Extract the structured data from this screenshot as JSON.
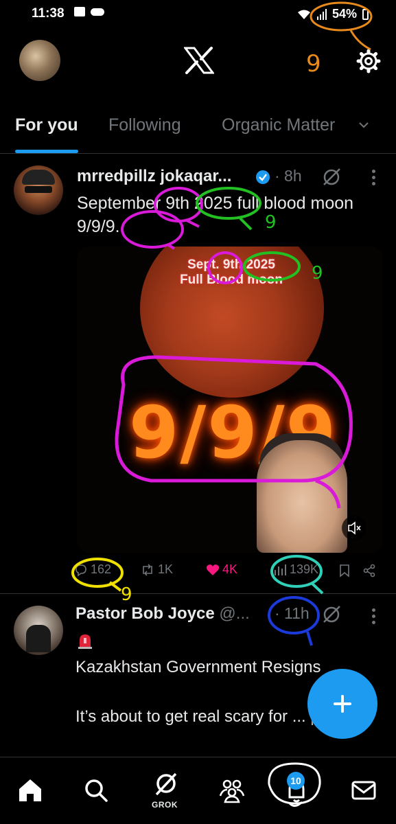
{
  "status_bar": {
    "time": "11:38",
    "battery": "54%"
  },
  "header": {
    "logo": "X"
  },
  "tabs": [
    {
      "label": "For you",
      "active": true
    },
    {
      "label": "Following",
      "active": false
    },
    {
      "label": "Organic Matter",
      "active": false
    }
  ],
  "posts": [
    {
      "author": "mrredpillz jokaqar...",
      "verified": true,
      "time": "· 8h",
      "text": "September 9th 2025 full blood moon 9/9/9.",
      "media": {
        "overlay_line1": "Sept. 9th 2025",
        "overlay_line2": "Full Blood moon",
        "big_text": "9/9/9"
      },
      "actions": {
        "replies": "162",
        "reposts": "1K",
        "likes": "4K",
        "views": "139K"
      }
    },
    {
      "author": "Pastor Bob Joyce",
      "handle": "@...",
      "time": "· 11h",
      "text": "Kazakhstan Government Resigns\n\nIt’s about to get real scary for ... people."
    }
  ],
  "annotations": {
    "nine_mark": "9"
  },
  "bottom_nav": {
    "grok_label": "GROK",
    "notifications_badge": "10"
  },
  "colors": {
    "accent": "#1d9bf0",
    "like": "#f91880",
    "muted": "#71767b"
  }
}
